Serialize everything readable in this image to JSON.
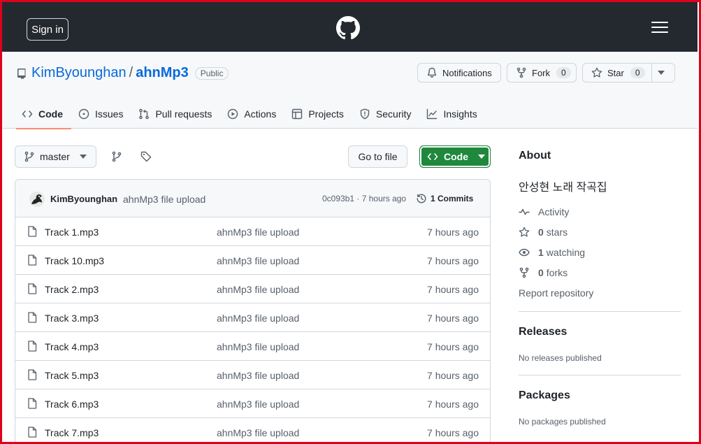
{
  "header": {
    "signin_label": "Sign in"
  },
  "repo": {
    "owner": "KimByounghan",
    "separator": "/",
    "name": "ahnMp3",
    "visibility": "Public"
  },
  "actions": {
    "notifications_label": "Notifications",
    "fork_label": "Fork",
    "fork_count": "0",
    "star_label": "Star",
    "star_count": "0"
  },
  "tabs": [
    {
      "label": "Code",
      "icon": "code-icon",
      "active": true
    },
    {
      "label": "Issues",
      "icon": "issue-icon"
    },
    {
      "label": "Pull requests",
      "icon": "pull-request-icon"
    },
    {
      "label": "Actions",
      "icon": "play-icon"
    },
    {
      "label": "Projects",
      "icon": "table-icon"
    },
    {
      "label": "Security",
      "icon": "shield-icon"
    },
    {
      "label": "Insights",
      "icon": "graph-icon"
    }
  ],
  "toolbar": {
    "branch": "master",
    "goto_file": "Go to file",
    "code_label": "Code"
  },
  "commit": {
    "author": "KimByounghan",
    "message": "ahnMp3 file upload",
    "meta": "0c093b1 · 7 hours ago",
    "commits": "1 Commits"
  },
  "files": [
    {
      "name": "Track 1.mp3",
      "message": "ahnMp3 file upload",
      "time": "7 hours ago"
    },
    {
      "name": "Track 10.mp3",
      "message": "ahnMp3 file upload",
      "time": "7 hours ago"
    },
    {
      "name": "Track 2.mp3",
      "message": "ahnMp3 file upload",
      "time": "7 hours ago"
    },
    {
      "name": "Track 3.mp3",
      "message": "ahnMp3 file upload",
      "time": "7 hours ago"
    },
    {
      "name": "Track 4.mp3",
      "message": "ahnMp3 file upload",
      "time": "7 hours ago"
    },
    {
      "name": "Track 5.mp3",
      "message": "ahnMp3 file upload",
      "time": "7 hours ago"
    },
    {
      "name": "Track 6.mp3",
      "message": "ahnMp3 file upload",
      "time": "7 hours ago"
    },
    {
      "name": "Track 7.mp3",
      "message": "ahnMp3 file upload",
      "time": "7 hours ago"
    }
  ],
  "about": {
    "title": "About",
    "description": "안성현 노래 작곡집",
    "activity": "Activity",
    "stars_count": "0",
    "stars_label": "stars",
    "watching_count": "1",
    "watching_label": "watching",
    "forks_count": "0",
    "forks_label": "forks",
    "report": "Report repository"
  },
  "releases": {
    "title": "Releases",
    "subtitle": "No releases published"
  },
  "packages": {
    "title": "Packages",
    "subtitle": "No packages published"
  },
  "colors": {
    "header_bg": "#24292f",
    "link": "#0969da",
    "code_button": "#1f883d",
    "tab_underline": "#fd8c73",
    "frame": "#e0001b"
  }
}
